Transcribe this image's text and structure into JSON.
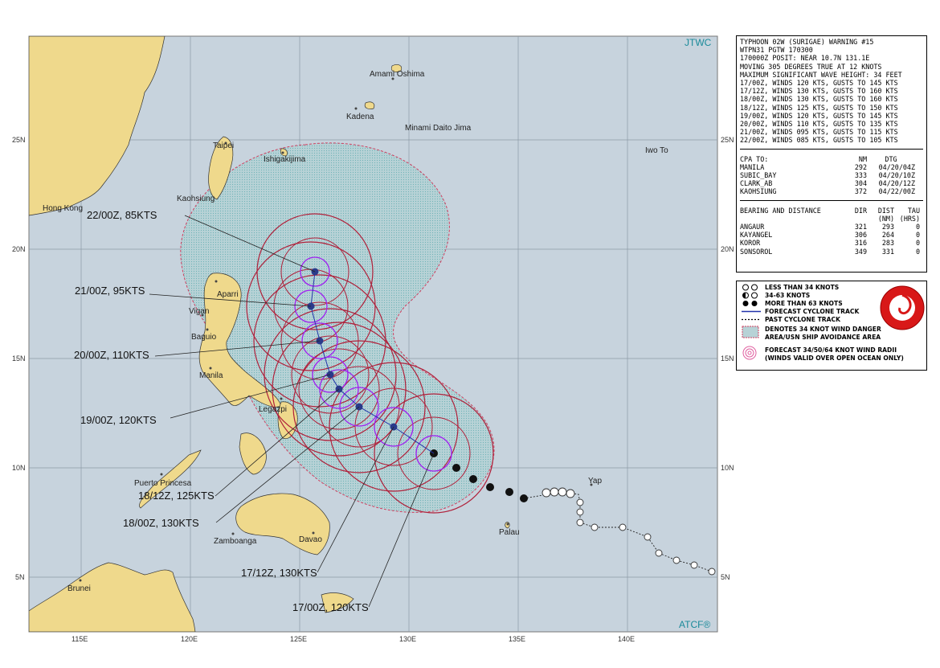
{
  "map": {
    "agency_top": "JTWC",
    "agency_bottom": "ATCF®",
    "lat_labels": [
      "25N",
      "20N",
      "15N",
      "10N",
      "5N"
    ],
    "lon_labels": [
      "115E",
      "120E",
      "125E",
      "130E",
      "135E",
      "140E"
    ],
    "places": {
      "amami": "Amami Oshima",
      "kadena": "Kadena",
      "minami": "Minami Daito Jima",
      "taipei": "Taipei",
      "ishigaki": "Ishigakijima",
      "iwoto": "Iwo To",
      "kaohsiung": "Kaohsiung",
      "hongkong": "Hong Kong",
      "aparri": "Aparri",
      "vigan": "Vigan",
      "baguio": "Baguio",
      "manila": "Manila",
      "legazpi": "Legazpi",
      "puerto": "Puerto Princesa",
      "zamboanga": "Zamboanga",
      "davao": "Davao",
      "palau": "Palau",
      "yap": "Yap",
      "brunei": "Brunei"
    },
    "forecast_labels": {
      "f22": "22/00Z,  85KTS",
      "f21": "21/00Z,  95KTS",
      "f20": "20/00Z, 110KTS",
      "f19": "19/00Z, 120KTS",
      "f1812": "18/12Z, 125KTS",
      "f18": "18/00Z, 130KTS",
      "f1712": "17/12Z, 130KTS",
      "f17": "17/00Z, 120KTS"
    }
  },
  "warning": {
    "lines": [
      "TYPHOON 02W (SURIGAE) WARNING #15",
      "WTPN31 PGTW 170300",
      "170000Z POSIT: NEAR 10.7N 131.1E",
      "MOVING 305 DEGREES TRUE AT 12 KNOTS",
      "MAXIMUM SIGNIFICANT WAVE HEIGHT: 34 FEET",
      "17/00Z, WINDS 120 KTS, GUSTS TO 145 KTS",
      "17/12Z, WINDS 130 KTS, GUSTS TO 160 KTS",
      "18/00Z, WINDS 130 KTS, GUSTS TO 160 KTS",
      "18/12Z, WINDS 125 KTS, GUSTS TO 150 KTS",
      "19/00Z, WINDS 120 KTS, GUSTS TO 145 KTS",
      "20/00Z, WINDS 110 KTS, GUSTS TO 135 KTS",
      "21/00Z, WINDS 095 KTS, GUSTS TO 115 KTS",
      "22/00Z, WINDS 085 KTS, GUSTS TO 105 KTS"
    ],
    "cpa_header": {
      "name": "CPA TO:",
      "nm": "NM",
      "dtg": "DTG"
    },
    "cpa": [
      {
        "name": "MANILA",
        "nm": "292",
        "dtg": "04/20/04Z"
      },
      {
        "name": "SUBIC_BAY",
        "nm": "333",
        "dtg": "04/20/10Z"
      },
      {
        "name": "CLARK_AB",
        "nm": "304",
        "dtg": "04/20/12Z"
      },
      {
        "name": "KAOHSIUNG",
        "nm": "372",
        "dtg": "04/22/00Z"
      }
    ],
    "bd_header": {
      "name": "BEARING AND DISTANCE",
      "dir": "DIR",
      "dist": "DIST",
      "tau": "TAU",
      "dist_unit": "(NM)",
      "tau_unit": "(HRS)"
    },
    "bd": [
      {
        "name": "ANGAUR",
        "dir": "321",
        "dist": "293",
        "tau": "0"
      },
      {
        "name": "KAYANGEL",
        "dir": "306",
        "dist": "264",
        "tau": "0"
      },
      {
        "name": "KOROR",
        "dir": "316",
        "dist": "283",
        "tau": "0"
      },
      {
        "name": "SONSOROL",
        "dir": "349",
        "dist": "331",
        "tau": "0"
      }
    ]
  },
  "legend": {
    "items": [
      "LESS THAN 34 KNOTS",
      "34-63 KNOTS",
      "MORE THAN 63 KNOTS",
      "FORECAST CYCLONE TRACK",
      "PAST CYCLONE TRACK",
      "DENOTES 34 KNOT WIND DANGER",
      "AREA/USN SHIP AVOIDANCE AREA",
      "FORECAST 34/50/64 KNOT WIND RADII",
      "(WINDS VALID OVER OPEN OCEAN ONLY)"
    ]
  },
  "colors": {
    "ocean": "#c7d3dd",
    "land": "#efd98c",
    "danger": "#a9cdd1",
    "radii": "#b0203a",
    "radii64": "#a020f0"
  }
}
